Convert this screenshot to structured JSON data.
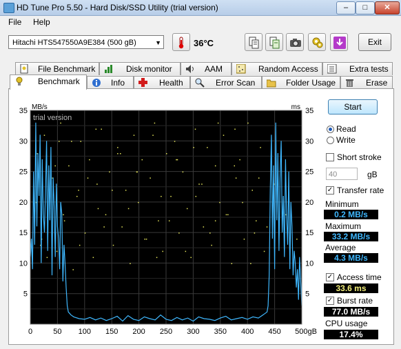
{
  "window": {
    "title": "HD Tune Pro 5.50 - Hard Disk/SSD Utility (trial version)",
    "min_label": "–",
    "max_label": "□",
    "close_label": "✕"
  },
  "menu": {
    "file": "File",
    "help": "Help"
  },
  "toolbar": {
    "drive": "Hitachi HTS547550A9E384 (500 gB)",
    "temperature": "36°C",
    "exit_label": "Exit"
  },
  "tabs": {
    "row1": [
      "File Benchmark",
      "Disk monitor",
      "AAM",
      "Random Access",
      "Extra tests"
    ],
    "row2": [
      "Benchmark",
      "Info",
      "Health",
      "Error Scan",
      "Folder Usage",
      "Erase"
    ],
    "active": "Benchmark"
  },
  "controls": {
    "start_label": "Start",
    "read_label": "Read",
    "write_label": "Write",
    "mode": "Read",
    "short_stroke_label": "Short stroke",
    "short_stroke_checked": false,
    "short_stroke_value": "40",
    "short_stroke_unit": "gB",
    "transfer_rate_label": "Transfer rate",
    "transfer_rate_checked": true,
    "access_time_label": "Access time",
    "access_time_checked": true,
    "burst_rate_label": "Burst rate",
    "burst_rate_checked": true
  },
  "stats": {
    "minimum_label": "Minimum",
    "minimum": "0.2 MB/s",
    "maximum_label": "Maximum",
    "maximum": "33.2 MB/s",
    "average_label": "Average",
    "average": "4.3 MB/s",
    "access_time": "33.6 ms",
    "burst_rate": "77.0 MB/s",
    "cpu_label": "CPU usage",
    "cpu": "17.4%"
  },
  "chart_data": {
    "type": "line",
    "watermark": "trial version",
    "ylabel_left": "MB/s",
    "ylabel_right": "ms",
    "y_ticks": [
      5,
      10,
      15,
      20,
      25,
      30,
      35
    ],
    "x_ticks": [
      "0",
      "50",
      "100",
      "150",
      "200",
      "250",
      "300",
      "350",
      "400",
      "450",
      "500gB"
    ],
    "xlim": [
      0,
      500
    ],
    "ylim": [
      0,
      35
    ],
    "grid": true,
    "colors": {
      "background": "#000000",
      "grid": "#3a3a3a",
      "transfer": "#3fb8ff",
      "access": "#e4e45a"
    },
    "series": [
      {
        "kind": "transfer",
        "x": [
          0,
          2,
          4,
          6,
          8,
          10,
          12,
          14,
          16,
          18,
          20,
          22,
          24,
          26,
          28,
          30,
          32,
          34,
          36,
          38,
          40,
          42,
          44,
          46,
          48,
          50,
          52,
          54,
          56,
          58,
          60,
          62,
          64,
          66,
          68,
          70,
          75,
          80,
          90,
          100,
          110,
          120,
          130,
          140,
          150,
          160,
          170,
          180,
          190,
          200,
          210,
          220,
          230,
          240,
          250,
          260,
          270,
          280,
          290,
          300,
          310,
          320,
          330,
          340,
          350,
          360,
          370,
          380,
          390,
          400,
          410,
          420,
          430,
          436,
          438,
          440,
          442,
          444,
          446,
          448,
          450,
          452,
          454,
          456,
          458,
          460,
          462,
          464,
          466,
          468,
          470,
          472,
          474,
          476,
          478,
          480,
          482,
          484,
          486,
          488,
          490,
          492,
          494,
          496,
          498,
          500
        ],
        "y": [
          11,
          14,
          9,
          25,
          13,
          33,
          16,
          28,
          21,
          31,
          10,
          27,
          18,
          15,
          22,
          30,
          12,
          26,
          17,
          29,
          8,
          24,
          19,
          11,
          23,
          16,
          14,
          9,
          20,
          18,
          7,
          13,
          10,
          6,
          3,
          2,
          1.5,
          1.2,
          0.9,
          0.8,
          1.1,
          0.7,
          1.0,
          0.6,
          0.9,
          1.3,
          0.5,
          1.4,
          0.8,
          0.6,
          1.2,
          0.9,
          0.7,
          1.5,
          0.8,
          0.6,
          1.1,
          0.7,
          1.0,
          0.5,
          1.2,
          0.9,
          0.8,
          0.6,
          1.0,
          1.3,
          0.7,
          0.9,
          1.1,
          0.8,
          1.2,
          1.0,
          1.6,
          2,
          3,
          8,
          22,
          31,
          14,
          26,
          9,
          33,
          17,
          28,
          12,
          24,
          30,
          15,
          21,
          11,
          27,
          18,
          13,
          25,
          9,
          20,
          16,
          8,
          12,
          10,
          6,
          9,
          4,
          11,
          7,
          3
        ]
      },
      {
        "kind": "access",
        "x": [
          12,
          20,
          25,
          35,
          40,
          48,
          55,
          62,
          70,
          78,
          85,
          92,
          100,
          108,
          115,
          122,
          130,
          138,
          145,
          152,
          160,
          168,
          175,
          183,
          190,
          198,
          205,
          213,
          220,
          228,
          235,
          243,
          250,
          258,
          265,
          273,
          280,
          288,
          295,
          303,
          310,
          318,
          325,
          333,
          340,
          348,
          355,
          363,
          370,
          378,
          385,
          393,
          400,
          408,
          415,
          423,
          430,
          10,
          30,
          45,
          60,
          75,
          90,
          105,
          120,
          135,
          150,
          165,
          180,
          195,
          210,
          225,
          240,
          255,
          270,
          285,
          300,
          315,
          330,
          345,
          360,
          375,
          390,
          405,
          420,
          435,
          18,
          52,
          88,
          124,
          160,
          196,
          232,
          268,
          304,
          340,
          376,
          412,
          448,
          470,
          490
        ],
        "y": [
          28,
          14,
          31,
          19,
          24,
          12,
          33,
          17,
          26,
          9,
          21,
          30,
          15,
          27,
          11,
          23,
          32,
          18,
          25,
          13,
          29,
          16,
          22,
          10,
          31,
          20,
          27,
          14,
          24,
          33,
          17,
          12,
          28,
          21,
          30,
          15,
          25,
          19,
          11,
          32,
          23,
          16,
          29,
          13,
          26,
          20,
          31,
          18,
          10,
          24,
          27,
          14,
          33,
          22,
          17,
          29,
          12,
          20,
          11,
          26,
          18,
          30,
          13,
          24,
          32,
          16,
          22,
          28,
          19,
          25,
          14,
          31,
          21,
          17,
          27,
          12,
          29,
          23,
          15,
          33,
          18,
          26,
          20,
          10,
          24,
          16,
          13,
          30,
          22,
          19,
          28,
          25,
          11,
          27,
          21,
          17,
          32,
          15,
          23,
          18,
          14
        ]
      }
    ]
  }
}
